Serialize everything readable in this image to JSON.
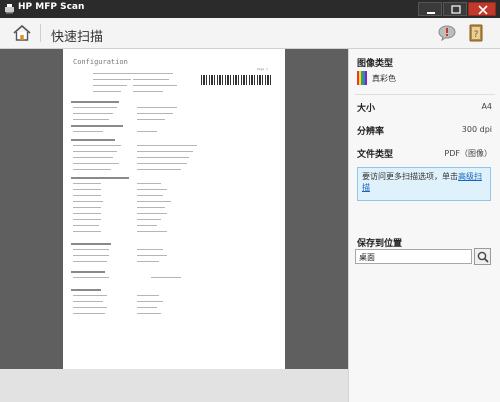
{
  "titlebar": {
    "title": "HP MFP Scan"
  },
  "toolbar": {
    "quick_scan_label": "快速扫描"
  },
  "document": {
    "title": "Configuration",
    "page_label": "Page 1"
  },
  "sidebar": {
    "image_type_label": "图像类型",
    "image_type_value": "真彩色",
    "size_label": "大小",
    "size_value": "A4",
    "resolution_label": "分辨率",
    "resolution_value": "300 dpi",
    "file_type_label": "文件类型",
    "file_type_value": "PDF（图像）",
    "info_text": "要访问更多扫描选项，单击",
    "info_link": "高级扫描",
    "save_to_label": "保存到位置",
    "save_to_value": "桌面"
  }
}
